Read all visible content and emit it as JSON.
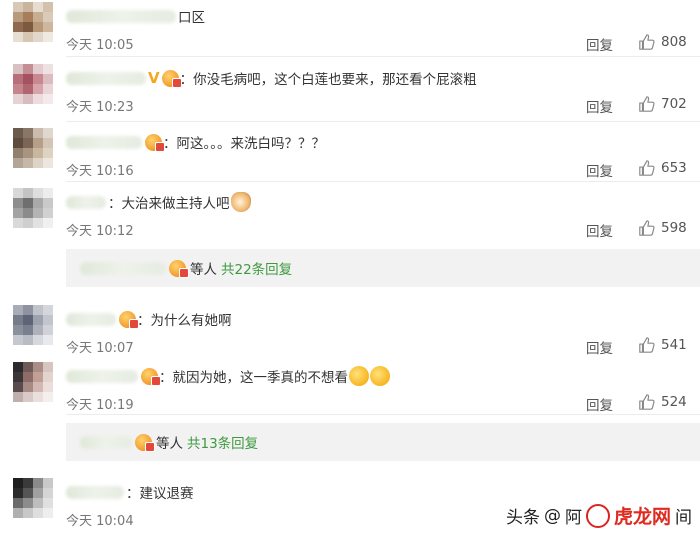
{
  "comments": [
    {
      "name_blur_w": 110,
      "text": "口区",
      "time": "今天 10:05",
      "reply": "回复",
      "likes": "808",
      "has_v": false,
      "badges": 0,
      "emoji": "",
      "avatar": [
        "#d8c9b7",
        "#c9b49c",
        "#e6ddd2",
        "#d3c1ab",
        "#b89a7c",
        "#a67e5c",
        "#c8ae90",
        "#dacbb8",
        "#8f6a4f",
        "#7b5a40",
        "#b79877",
        "#cdb79e",
        "#e8dfd4",
        "#d6c6b2",
        "#e2d7ca",
        "#efe9e2"
      ]
    },
    {
      "name_blur_w": 80,
      "text": "：你没毛病吧，这个白莲也要来，那还看个屁滚粗",
      "time": "今天 10:23",
      "reply": "回复",
      "likes": "702",
      "has_v": true,
      "badges": 1,
      "emoji": "",
      "avatar": [
        "#d9c0c2",
        "#c48f94",
        "#e3ccce",
        "#efe0e1",
        "#b86f7a",
        "#a4525f",
        "#c98890",
        "#dcbcbf",
        "#c4858c",
        "#b0666f",
        "#d6a4aa",
        "#e9d5d7",
        "#e6d3d4",
        "#d9bcbf",
        "#ecdcdd",
        "#f4eaeb"
      ]
    },
    {
      "name_blur_w": 76,
      "text": "：阿这。。。来洗白吗？？？",
      "time": "今天 10:16",
      "reply": "回复",
      "likes": "653",
      "has_v": false,
      "badges": 1,
      "emoji": "",
      "avatar": [
        "#6b5a4e",
        "#8a7666",
        "#c9bcae",
        "#e1d8cd",
        "#5d4b3f",
        "#7c6554",
        "#b59f88",
        "#d4c6b6",
        "#92806e",
        "#a89480",
        "#c8b69f",
        "#ded2c3",
        "#b4a695",
        "#c5b8a8",
        "#ddd3c7",
        "#ece6de"
      ]
    },
    {
      "name_blur_w": 40,
      "text": "：大治来做主持人吧",
      "time": "今天 10:12",
      "reply": "回复",
      "likes": "598",
      "has_v": false,
      "badges": 0,
      "emoji": "cat",
      "avatar": [
        "#d8d8d8",
        "#c4c4c4",
        "#dedede",
        "#ececec",
        "#8e8e8e",
        "#6f6f6f",
        "#a9a9a9",
        "#c9c9c9",
        "#a3a3a3",
        "#8b8b8b",
        "#b4b4b4",
        "#d1d1d1",
        "#d9d9d9",
        "#cfcfcf",
        "#e2e2e2",
        "#f0f0f0"
      ]
    },
    {
      "name_blur_w": 50,
      "text": "：为什么有她啊",
      "time": "今天 10:07",
      "reply": "回复",
      "likes": "541",
      "has_v": false,
      "badges": 1,
      "emoji": "",
      "avatar": [
        "#a9acb6",
        "#8f93a1",
        "#c0c3cc",
        "#d4d6dc",
        "#777c8c",
        "#5f6577",
        "#9ea2ae",
        "#c2c5cd",
        "#8c909c",
        "#7a7f8d",
        "#aeb1bb",
        "#d0d2d8",
        "#c6c8cf",
        "#b9bcc4",
        "#d6d8dd",
        "#e8e9ec"
      ]
    },
    {
      "name_blur_w": 72,
      "text": "：就因为她，这一季真的不想看",
      "time": "今天 10:19",
      "reply": "回复",
      "likes": "524",
      "has_v": false,
      "badges": 1,
      "emoji": "double",
      "avatar": [
        "#2c2a2e",
        "#6e5a56",
        "#a98e86",
        "#d7c6c0",
        "#3d3538",
        "#8e6d68",
        "#c29f95",
        "#e3d4cf",
        "#5a4c4e",
        "#a88a84",
        "#d2b8b0",
        "#ecdfdb",
        "#bfb0ad",
        "#d8cbc7",
        "#e9e0dd",
        "#f4efed"
      ]
    },
    {
      "name_blur_w": 58,
      "text": "：建议退赛",
      "time": "今天 10:04",
      "reply": "",
      "likes": "",
      "has_v": false,
      "badges": 0,
      "emoji": "",
      "avatar": [
        "#1f1f1f",
        "#3a3a3a",
        "#8a8a8a",
        "#c9c9c9",
        "#2b2b2b",
        "#555555",
        "#a0a0a0",
        "#d5d5d5",
        "#6a6a6a",
        "#8c8c8c",
        "#bdbdbd",
        "#e0e0e0",
        "#b0b0b0",
        "#c8c8c8",
        "#dedede",
        "#eeeeee"
      ]
    }
  ],
  "subreplies": [
    {
      "suffix": "等人",
      "more": "共22条回复"
    },
    {
      "suffix": "等人",
      "more": "共13条回复"
    }
  ],
  "watermark": {
    "prefix": "头条",
    "at": "@",
    "name_a": "阿",
    "name_b": "虎龙网",
    "name_c": "间"
  }
}
